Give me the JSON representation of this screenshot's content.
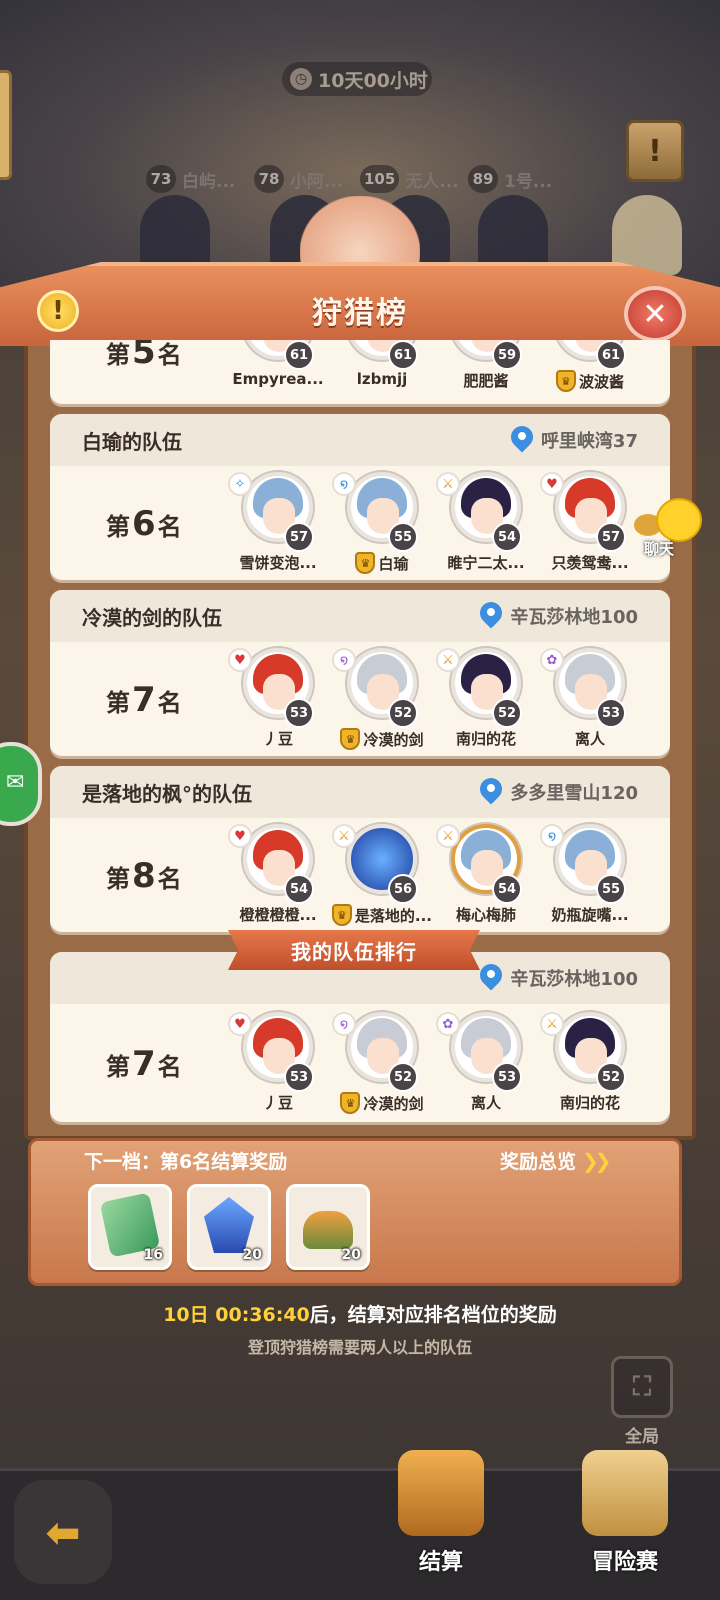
{
  "header": {
    "countdown": "10天00小时",
    "title": "狩猎榜",
    "top_players": [
      {
        "level": "73",
        "name": "白屿..."
      },
      {
        "level": "78",
        "name": "小阿..."
      },
      {
        "level": "105",
        "name": "无人..."
      },
      {
        "level": "89",
        "name": "1号..."
      }
    ]
  },
  "teams": [
    {
      "rank_prefix": "第",
      "rank_num": "5",
      "rank_suffix": "名",
      "members": [
        {
          "name": "Empyrea...",
          "level": "61",
          "leader": false
        },
        {
          "name": "lzbmjj",
          "level": "61",
          "leader": false
        },
        {
          "name": "肥肥酱",
          "level": "59",
          "leader": false
        },
        {
          "name": "波波酱",
          "level": "61",
          "leader": true
        }
      ]
    },
    {
      "team_name": "白瑜的队伍",
      "location": "呼里峡湾37",
      "rank_prefix": "第",
      "rank_num": "6",
      "rank_suffix": "名",
      "members": [
        {
          "name": "雪饼变泡...",
          "level": "57",
          "leader": false
        },
        {
          "name": "白瑜",
          "level": "55",
          "leader": true
        },
        {
          "name": "睢宁二太...",
          "level": "54",
          "leader": false
        },
        {
          "name": "只羡鸳鸯...",
          "level": "57",
          "leader": false
        }
      ]
    },
    {
      "team_name": "冷漠的剑的队伍",
      "location": "辛瓦莎林地100",
      "rank_prefix": "第",
      "rank_num": "7",
      "rank_suffix": "名",
      "members": [
        {
          "name": "丿豆",
          "level": "53",
          "leader": false
        },
        {
          "name": "冷漠的剑",
          "level": "52",
          "leader": true
        },
        {
          "name": "南归的花",
          "level": "52",
          "leader": false
        },
        {
          "name": "离人",
          "level": "53",
          "leader": false
        }
      ]
    },
    {
      "team_name": "是落地的枫°的队伍",
      "location": "多多里雪山120",
      "rank_prefix": "第",
      "rank_num": "8",
      "rank_suffix": "名",
      "members": [
        {
          "name": "橙橙橙橙...",
          "level": "54",
          "leader": false
        },
        {
          "name": "是落地的...",
          "level": "56",
          "leader": true
        },
        {
          "name": "梅心梅肺",
          "level": "54",
          "leader": false
        },
        {
          "name": "奶瓶旋嘴...",
          "level": "55",
          "leader": false
        }
      ]
    }
  ],
  "my_team": {
    "banner": "我的队伍排行",
    "location": "辛瓦莎林地100",
    "rank_prefix": "第",
    "rank_num": "7",
    "rank_suffix": "名",
    "members": [
      {
        "name": "丿豆",
        "level": "53",
        "leader": false
      },
      {
        "name": "冷漠的剑",
        "level": "52",
        "leader": true
      },
      {
        "name": "离人",
        "level": "53",
        "leader": false
      },
      {
        "name": "南归的花",
        "level": "52",
        "leader": false
      }
    ]
  },
  "rewards": {
    "next_tier": "下一档：第6名结算奖励",
    "overview": "奖励总览",
    "items": [
      {
        "icon": "green-ticket-icon",
        "qty": "16"
      },
      {
        "icon": "blue-crystal-icon",
        "qty": "20"
      },
      {
        "icon": "food-plate-icon",
        "qty": "20"
      }
    ],
    "settle_time": "10日 00:36:40",
    "settle_text": "后，结算对应排名档位的奖励",
    "hint": "登顶狩猎榜需要两人以上的队伍"
  },
  "side": {
    "chat_label": "聊天",
    "global_label": "全局"
  },
  "bottom_nav": {
    "settle_label": "结算",
    "adventure_label": "冒险赛"
  },
  "colors": {
    "accent_orange": "#e6784a",
    "gold": "#ffd23a",
    "card_bg": "#fbf5ea",
    "location_pin": "#3a8fe0"
  }
}
